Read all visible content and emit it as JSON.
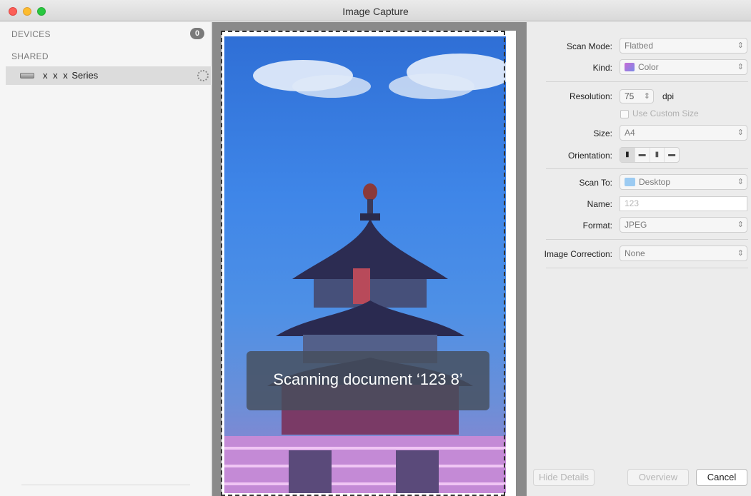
{
  "window": {
    "title": "Image Capture"
  },
  "sidebar": {
    "devices_header": "DEVICES",
    "devices_count": "0",
    "shared_header": "SHARED",
    "device": {
      "name_prefix": "x x x",
      "name_suffix": "Series"
    }
  },
  "preview": {
    "status_message": "Scanning document ‘123 8’"
  },
  "details": {
    "scan_mode": {
      "label": "Scan Mode:",
      "value": "Flatbed"
    },
    "kind": {
      "label": "Kind:",
      "value": "Color"
    },
    "resolution": {
      "label": "Resolution:",
      "value": "75",
      "unit": "dpi"
    },
    "custom_size": {
      "label": "Use Custom Size",
      "checked": false
    },
    "size": {
      "label": "Size:",
      "value": "A4"
    },
    "orientation": {
      "label": "Orientation:",
      "options": [
        "portrait",
        "landscape-left",
        "portrait-flipped",
        "landscape-right"
      ],
      "selected": "portrait"
    },
    "scan_to": {
      "label": "Scan To:",
      "value": "Desktop"
    },
    "name": {
      "label": "Name:",
      "placeholder": "123"
    },
    "format": {
      "label": "Format:",
      "value": "JPEG"
    },
    "image_correction": {
      "label": "Image Correction:",
      "value": "None"
    }
  },
  "buttons": {
    "hide_details": "Hide Details",
    "overview": "Overview",
    "cancel": "Cancel"
  },
  "colors": {
    "close": "#fc5f57",
    "minimize": "#fdbc2e",
    "maximize": "#28c840",
    "sky": "#3f86e8",
    "overlay": "#464e5c"
  }
}
